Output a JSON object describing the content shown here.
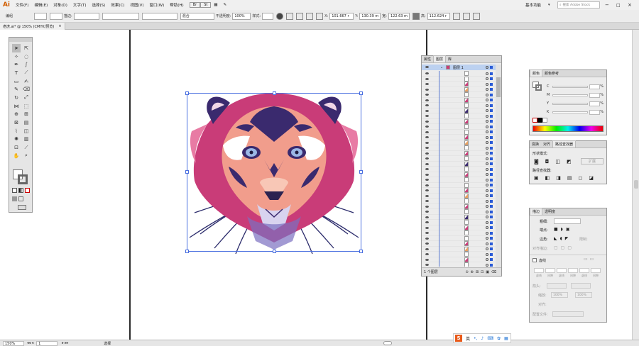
{
  "app": {
    "logo": "Ai"
  },
  "menu": [
    "文件(F)",
    "编辑(E)",
    "对象(O)",
    "文字(T)",
    "选择(S)",
    "效果(C)",
    "视图(V)",
    "窗口(W)",
    "帮助(H)"
  ],
  "workspace": {
    "label": "基本功能",
    "search_placeholder": "搜索 Adobe Stock"
  },
  "control": {
    "group": "编组",
    "stroke_label": "描边:",
    "blend": "混合",
    "opacity_label": "不透明度:",
    "opacity_value": "100%",
    "style_label": "样式:",
    "x_label": "X:",
    "x": "101.667 r",
    "y_label": "Y:",
    "y": "130.39 m",
    "w_label": "宽:",
    "w": "122.63 m",
    "h_label": "高:",
    "h": "112.624 r"
  },
  "document": {
    "tab": "老虎.ai* @ 150% (CMYK/预览)",
    "close": "×"
  },
  "layers": {
    "tabs": [
      "属性",
      "图层",
      "库"
    ],
    "layer_name": "图层 1",
    "footer": "1 个图层",
    "row_count": 38
  },
  "color_panel": {
    "tabs": [
      "颜色",
      "颜色参考"
    ],
    "channels": [
      "C",
      "M",
      "Y",
      "K"
    ],
    "unit": "%"
  },
  "pathfinder": {
    "tabs": [
      "变换",
      "对齐",
      "路径查找器"
    ],
    "shape_modes": "形状模式:",
    "expand": "扩展",
    "pathfinders": "路径查找器:"
  },
  "stroke_panel": {
    "tabs": [
      "描边",
      "透明度"
    ],
    "weight": "粗细:",
    "cap": "端点:",
    "corner": "边角:",
    "limit": "限制:",
    "align": "对齐描边:",
    "dashed": "虚线",
    "dash_labels": [
      "虚线",
      "间隙",
      "虚线",
      "间隙",
      "虚线",
      "间隙"
    ],
    "arrow": "箭头:",
    "scale": "缩放:",
    "scale1": "100%",
    "scale2": "100%",
    "align_arrow": "对齐:",
    "profile": "配置文件:"
  },
  "status": {
    "zoom": "150%",
    "page": "1",
    "tool": "选择"
  },
  "ime": {
    "lang": "英"
  },
  "colors": {
    "selection": "#4a6fe0",
    "accent": "#2a5bd7"
  }
}
